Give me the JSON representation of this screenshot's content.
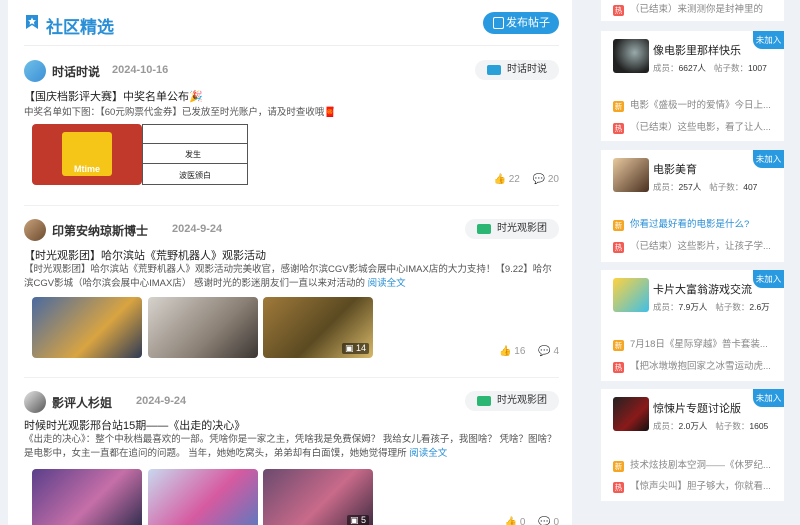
{
  "header": {
    "title": "社区精选",
    "publish": "发布帖子"
  },
  "posts": [
    {
      "author": "时话时说",
      "date": "2024-10-16",
      "group": "时话时说",
      "title": "【国庆档影评大赛】中奖名单公布🎉",
      "body": "中奖名单如下图：【60元购票代金券】已发放至时光账户，请及时查收哦🧧",
      "poster_rows": [
        "发生",
        "波医颁白"
      ],
      "likes": "22",
      "comments": "20"
    },
    {
      "author": "印第安纳琼斯博士",
      "date": "2024-9-24",
      "group": "时光观影团",
      "title": "【时光观影团】哈尔滨站《荒野机器人》观影活动",
      "body": "【时光观影团】哈尔滨站《荒野机器人》观影活动完美收官，感谢哈尔滨CGV影城会展中心IMAX店的大力支持！【9.22】哈尔滨CGV影城（哈尔滨会展中心IMAX店） 感谢时光的影迷朋友们一直以来对活动的",
      "more": "阅读全文",
      "photo_count": "14",
      "likes": "16",
      "comments": "4"
    },
    {
      "author": "影评人杉姐",
      "date": "2024-9-24",
      "group": "时光观影团",
      "title": "时候时光观影邢台站15期——《出走的决心》",
      "body": "《出走的决心》：整个中秋档最喜欢的一部。凭啥你是一家之主，凭啥我是免费保姆？ 我给女儿看孩子，我图啥？ 凭啥？图啥？是电影中，女主一直都在追问的问题。 当年，她她吃窝头，弟弟却有白面馍，她她觉得理所",
      "more": "阅读全文",
      "photo_count": "5",
      "likes": "0",
      "comments": "0"
    }
  ],
  "sidebar": {
    "top_lines": [
      {
        "tag": "热",
        "text": "（已结束）来测测你是封神里的"
      }
    ],
    "cards": [
      {
        "name": "像电影里那样快乐",
        "members": "6627人",
        "posts": "1007",
        "join": "未加入",
        "lines": [
          {
            "tag": "新",
            "text": "电影《盛极一时的爱情》今日上..."
          },
          {
            "tag": "热",
            "text": "（已结束）这些电影，看了让人..."
          }
        ]
      },
      {
        "name": "电影美育",
        "members": "257人",
        "posts": "407",
        "join": "未加入",
        "lines": [
          {
            "tag": "新",
            "text": "你看过最好看的电影是什么?"
          },
          {
            "tag": "热",
            "text": "（已结束）这些影片，让孩子学..."
          }
        ]
      },
      {
        "name": "卡片大富翁游戏交流",
        "members": "7.9万人",
        "posts": "2.6万",
        "join": "未加入",
        "lines": [
          {
            "tag": "新",
            "text": "7月18日《星际穿越》普卡套装..."
          },
          {
            "tag": "热",
            "text": "【把冰墩墩抱回家之冰雪运动虎..."
          }
        ]
      },
      {
        "name": "惊悚片专题讨论版",
        "members": "2.0万人",
        "posts": "1605",
        "join": "未加入",
        "lines": [
          {
            "tag": "新",
            "text": "技术炫技剧本空洞——《休罗纪..."
          },
          {
            "tag": "热",
            "text": "【惊声尖叫】胆子够大，你就看..."
          }
        ]
      }
    ],
    "labels": {
      "members": "成员：",
      "posts": "帖子数："
    }
  }
}
